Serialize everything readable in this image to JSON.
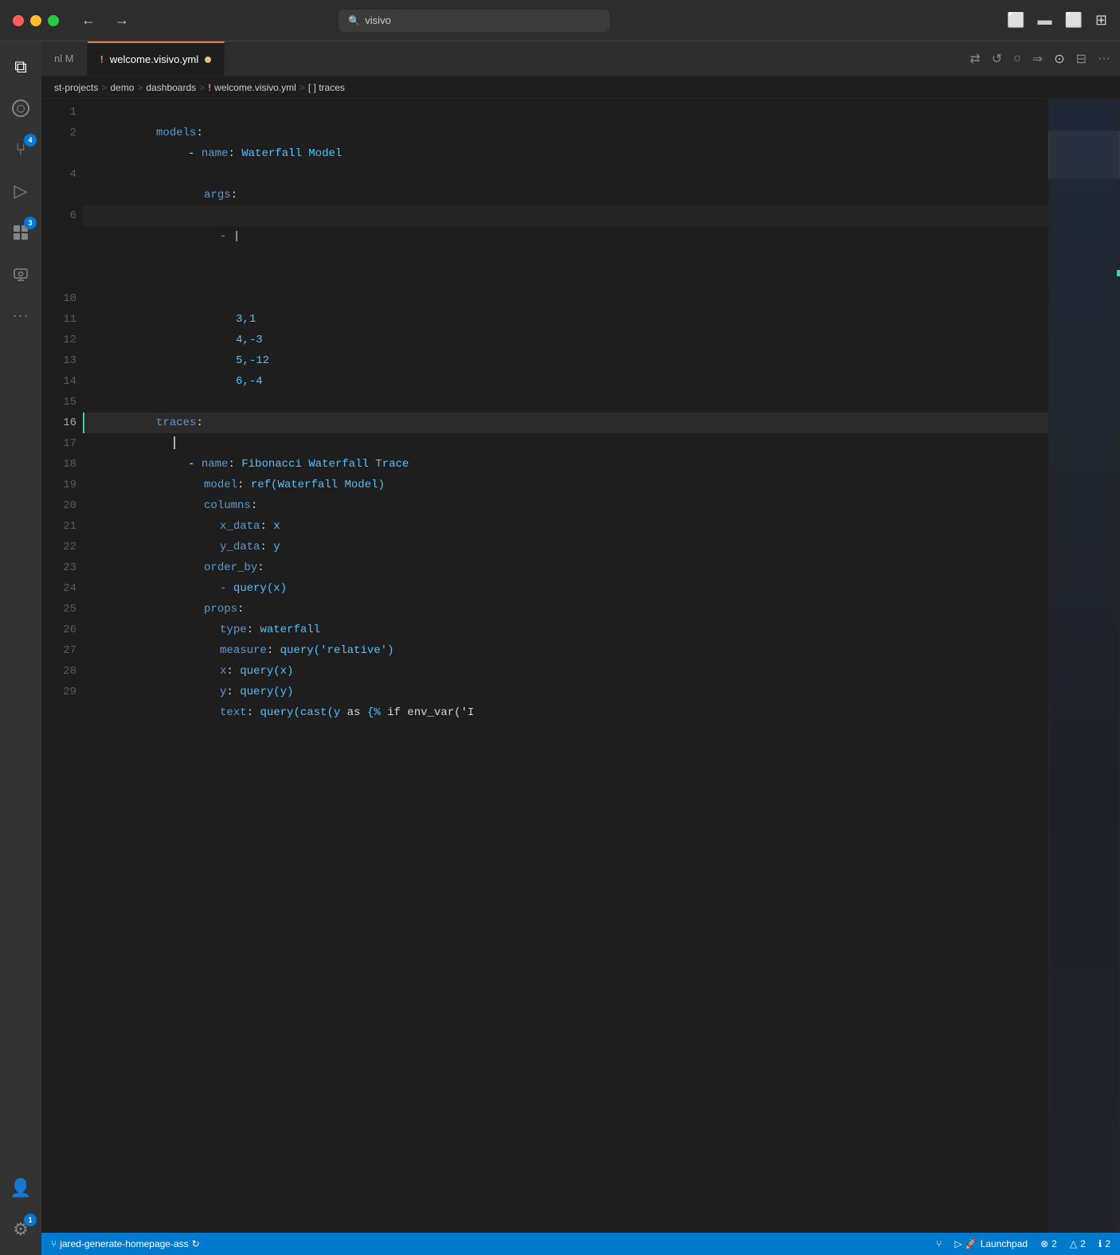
{
  "titlebar": {
    "search_text": "visivo",
    "nav_back": "←",
    "nav_forward": "→"
  },
  "tabs": [
    {
      "id": "tab1",
      "label": "nl M",
      "exclaim": false,
      "active": false,
      "modified": false
    },
    {
      "id": "tab2",
      "label": "welcome.visivo.yml",
      "exclaim": true,
      "active": true,
      "modified": true
    }
  ],
  "breadcrumb": {
    "items": [
      "st-projects",
      "demo",
      "dashboards",
      "welcome.visivo.yml",
      "[ ] traces"
    ]
  },
  "code": {
    "lines": [
      {
        "num": 1,
        "content": "models:"
      },
      {
        "num": 2,
        "content": "    - name: Waterfall Model"
      },
      {
        "num": 4,
        "content": "      args:"
      },
      {
        "num": 6,
        "content": "        - |"
      },
      {
        "num": 10,
        "content": "          3,1"
      },
      {
        "num": 11,
        "content": "          4,-3"
      },
      {
        "num": 12,
        "content": "          5,-12"
      },
      {
        "num": 13,
        "content": "          6,-4"
      },
      {
        "num": 14,
        "content": ""
      },
      {
        "num": 15,
        "content": "traces:"
      },
      {
        "num": 16,
        "content": "  "
      },
      {
        "num": 17,
        "content": "    - name: Fibonacci Waterfall Trace"
      },
      {
        "num": 18,
        "content": "      model: ref(Waterfall Model)"
      },
      {
        "num": 19,
        "content": "      columns:"
      },
      {
        "num": 20,
        "content": "        x_data: x"
      },
      {
        "num": 21,
        "content": "        y_data: y"
      },
      {
        "num": 22,
        "content": "      order_by:"
      },
      {
        "num": 23,
        "content": "        - query(x)"
      },
      {
        "num": 24,
        "content": "      props:"
      },
      {
        "num": 25,
        "content": "        type: waterfall"
      },
      {
        "num": 26,
        "content": "        measure: query('relative')"
      },
      {
        "num": 27,
        "content": "        x: query(x)"
      },
      {
        "num": 28,
        "content": "        y: query(y)"
      },
      {
        "num": 29,
        "content": "        text: query(cast(y as {% if env_var('I"
      }
    ]
  },
  "activity_bar": {
    "items": [
      {
        "id": "explorer",
        "icon": "⧉",
        "badge": null,
        "active": true
      },
      {
        "id": "search",
        "icon": "○",
        "badge": null,
        "active": false
      },
      {
        "id": "source-control",
        "icon": "⑂",
        "badge": 4,
        "active": false
      },
      {
        "id": "run",
        "icon": "▷",
        "badge": null,
        "active": false
      },
      {
        "id": "extensions",
        "icon": "⊞",
        "badge": 3,
        "active": false
      },
      {
        "id": "remote",
        "icon": "⊡",
        "badge": null,
        "active": false
      }
    ],
    "bottom": [
      {
        "id": "account",
        "icon": "👤",
        "badge": null
      },
      {
        "id": "settings",
        "icon": "⚙",
        "badge": 1
      }
    ]
  },
  "status_bar": {
    "branch_icon": "⑂",
    "branch_name": "jared-generate-homepage-ass",
    "sync_icon": "↻",
    "merge_icon": "⑂",
    "run_icon": "▷",
    "launchpad_label": "Launchpad",
    "errors": 2,
    "warnings": 2,
    "info": 2,
    "arrows": "⇌"
  }
}
